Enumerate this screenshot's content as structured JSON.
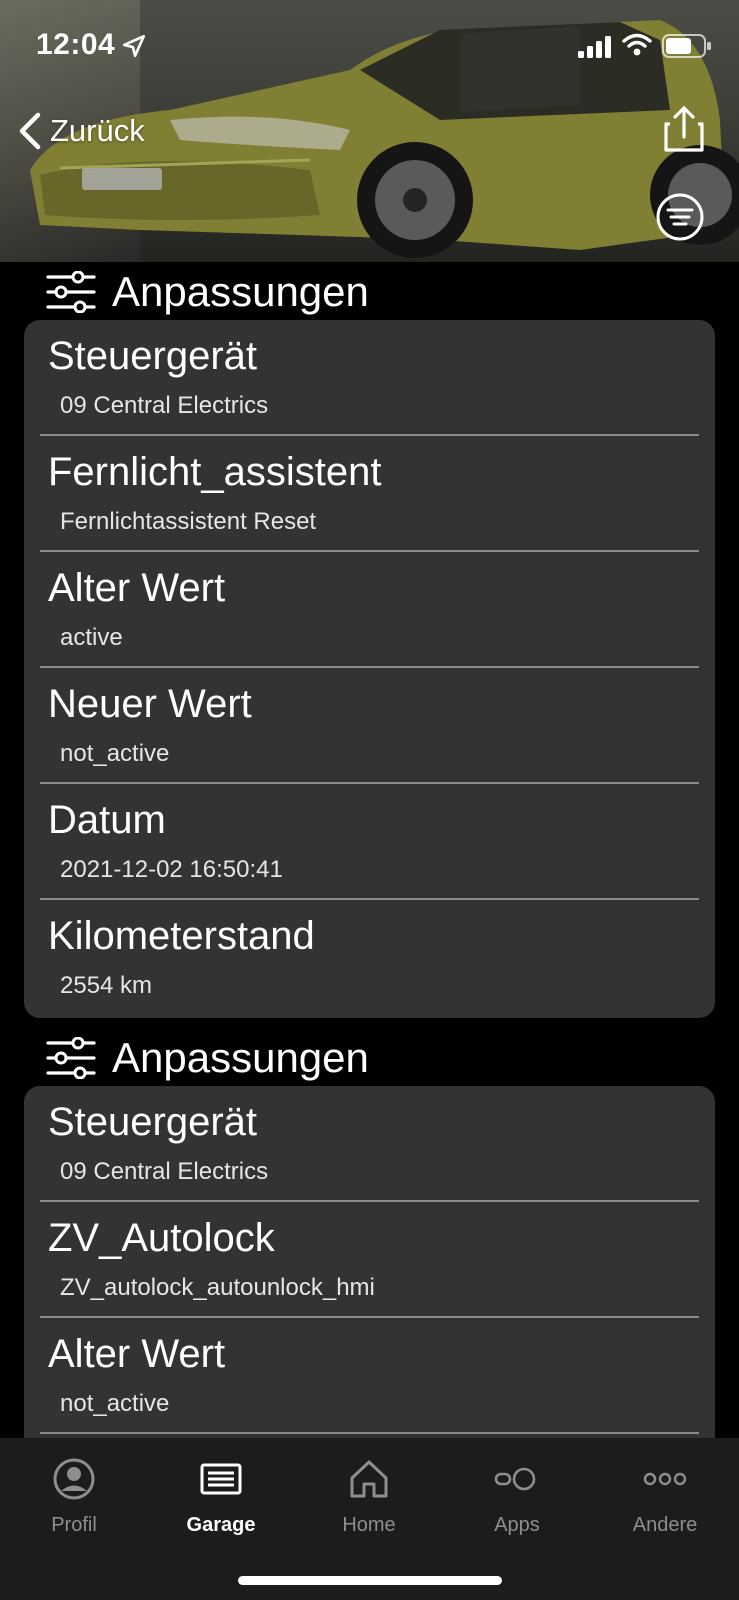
{
  "status_bar": {
    "time": "12:04"
  },
  "nav": {
    "back_label": "Zurück"
  },
  "sections": [
    {
      "title": "Anpassungen",
      "rows": [
        {
          "label": "Steuergerät",
          "value": "09 Central Electrics"
        },
        {
          "label": "Fernlicht_assistent",
          "value": "Fernlichtassistent Reset"
        },
        {
          "label": "Alter Wert",
          "value": "active"
        },
        {
          "label": "Neuer Wert",
          "value": "not_active"
        },
        {
          "label": "Datum",
          "value": "2021-12-02 16:50:41"
        },
        {
          "label": "Kilometerstand",
          "value": "2554 km"
        }
      ]
    },
    {
      "title": "Anpassungen",
      "rows": [
        {
          "label": "Steuergerät",
          "value": "09 Central Electrics"
        },
        {
          "label": "ZV_Autolock",
          "value": "ZV_autolock_autounlock_hmi"
        },
        {
          "label": "Alter Wert",
          "value": "not_active"
        }
      ]
    }
  ],
  "tabbar": {
    "active": "Garage",
    "items": [
      {
        "label": "Profil",
        "icon": "profile-icon"
      },
      {
        "label": "Garage",
        "icon": "garage-icon"
      },
      {
        "label": "Home",
        "icon": "home-icon"
      },
      {
        "label": "Apps",
        "icon": "apps-icon"
      },
      {
        "label": "Andere",
        "icon": "more-icon"
      }
    ]
  },
  "colors": {
    "card": "#333335",
    "tabbar": "#1c1c1e",
    "inactive_tab": "#8e8e90",
    "car_body": "#a6a544"
  }
}
